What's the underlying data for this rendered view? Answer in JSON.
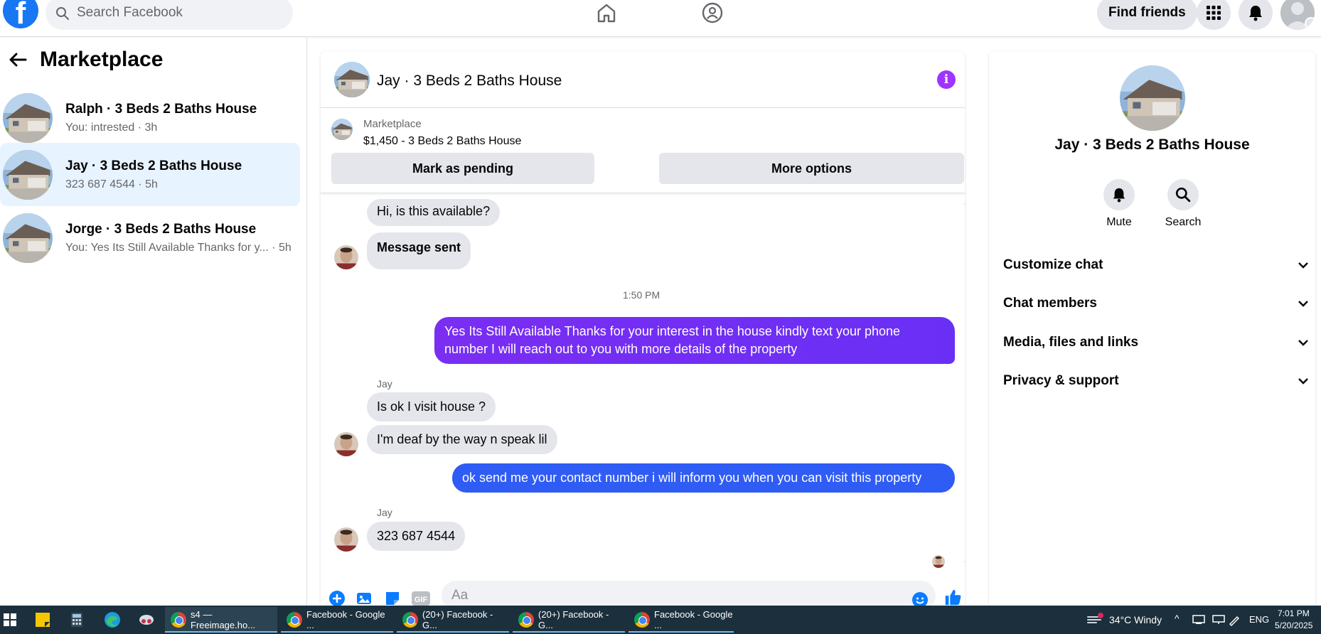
{
  "topbar": {
    "search_placeholder": "Search Facebook",
    "find_friends_label": "Find friends",
    "brand_color": "#1877f2"
  },
  "sidebar": {
    "title": "Marketplace",
    "conversations": [
      {
        "name": "Ralph · 3 Beds 2 Baths House",
        "preview": "You: intrested · 3h",
        "active": false
      },
      {
        "name": "Jay · 3 Beds 2 Baths House",
        "preview": "323 687 4544 · 5h",
        "active": true
      },
      {
        "name": "Jorge · 3 Beds 2 Baths House",
        "preview": "You: Yes Its Still Available Thanks for y... · 5h",
        "active": false
      }
    ]
  },
  "chat": {
    "title": "Jay · 3 Beds 2 Baths House",
    "marketplace_label": "Marketplace",
    "listing": "$1,450 - 3 Beds 2 Baths House",
    "mark_pending_label": "Mark as pending",
    "more_options_label": "More options",
    "messages": {
      "m1": "Hi, is this available?",
      "m2": "Message sent",
      "timestamp": "1:50 PM",
      "m3": "Yes Its Still Available Thanks for your interest in the house kindly text your phone number I will reach out to you with more details of the property",
      "sender1": "Jay",
      "m4": "Is ok I visit house ?",
      "m5": "I'm deaf by the way n speak lil",
      "m6": "ok send me your contact number i will inform you when you can visit this property",
      "sender2": "Jay",
      "m7": "323 687 4544"
    },
    "composer_placeholder": "Aa",
    "accent_color": "#a033ff"
  },
  "right_panel": {
    "title": "Jay · 3 Beds 2 Baths House",
    "mute_label": "Mute",
    "search_label": "Search",
    "sections": [
      "Customize chat",
      "Chat members",
      "Media, files and links",
      "Privacy & support"
    ]
  },
  "taskbar": {
    "tasks": [
      "s4 — Freeimage.ho...",
      "Facebook - Google ...",
      "(20+) Facebook - G...",
      "(20+) Facebook - G...",
      "Facebook - Google ..."
    ],
    "weather": "34°C  Windy",
    "language": "ENG",
    "time": "7:01 PM",
    "date": "5/20/2025"
  }
}
